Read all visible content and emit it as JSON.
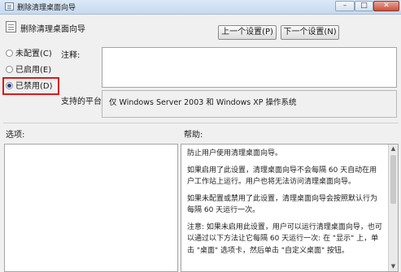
{
  "window": {
    "title": "删除清理桌面向导",
    "controls": {
      "minimize": "–",
      "maximize": "□",
      "close": "✕"
    }
  },
  "header": {
    "policy_name": "删除清理桌面向导",
    "prev_button": "上一个设置(P)",
    "next_button": "下一个设置(N)"
  },
  "options": [
    {
      "label": "未配置(C)",
      "checked": false
    },
    {
      "label": "已启用(E)",
      "checked": false
    },
    {
      "label": "已禁用(D)",
      "checked": true
    }
  ],
  "comment": {
    "label": "注释:",
    "value": ""
  },
  "platform": {
    "label": "支持的平台:",
    "value": "仅 Windows Server 2003 和 Windows XP 操作系统"
  },
  "sections": {
    "options_label": "选项:",
    "help_label": "帮助:"
  },
  "help": {
    "paragraphs": [
      "防止用户使用清理桌面向导。",
      "如果启用了此设置，清理桌面向导不会每隔 60 天自动在用户工作站上运行。用户也将无法访问清理桌面向导。",
      "如果未配置或禁用了此设置，清理桌面向导会按照默认行为每隔 60 天运行一次。",
      "注意: 如果未启用此设置，用户可以运行清理桌面向导，也可以通过以下方法让它每隔 60 天运行一次: 在 \"显示\" 上，单击 \"桌面\" 选项卡，然后单击 \"自定义桌面\" 按钮。"
    ]
  },
  "colors": {
    "highlight": "#d81b1b",
    "title_bar": "#c6d9ee"
  }
}
